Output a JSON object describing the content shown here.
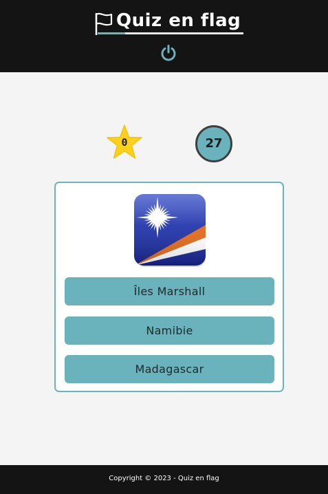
{
  "header": {
    "logo_text": "Quiz en flag",
    "logo_icon": "flag-icon",
    "power_icon": "power-icon"
  },
  "scores": {
    "stars": "0",
    "star_icon": "star-icon",
    "timer": "27"
  },
  "question": {
    "flag_image": "marshall-islands-flag",
    "answers": [
      {
        "label": "Îles Marshall"
      },
      {
        "label": "Namibie"
      },
      {
        "label": "Madagascar"
      }
    ]
  },
  "footer": {
    "copyright": "Copyright © 2023 - Quiz en flag"
  },
  "colors": {
    "header_bg": "#141414",
    "accent": "#6ab3bc",
    "page_bg": "#f4f4f4",
    "star": "#fcd11b"
  }
}
